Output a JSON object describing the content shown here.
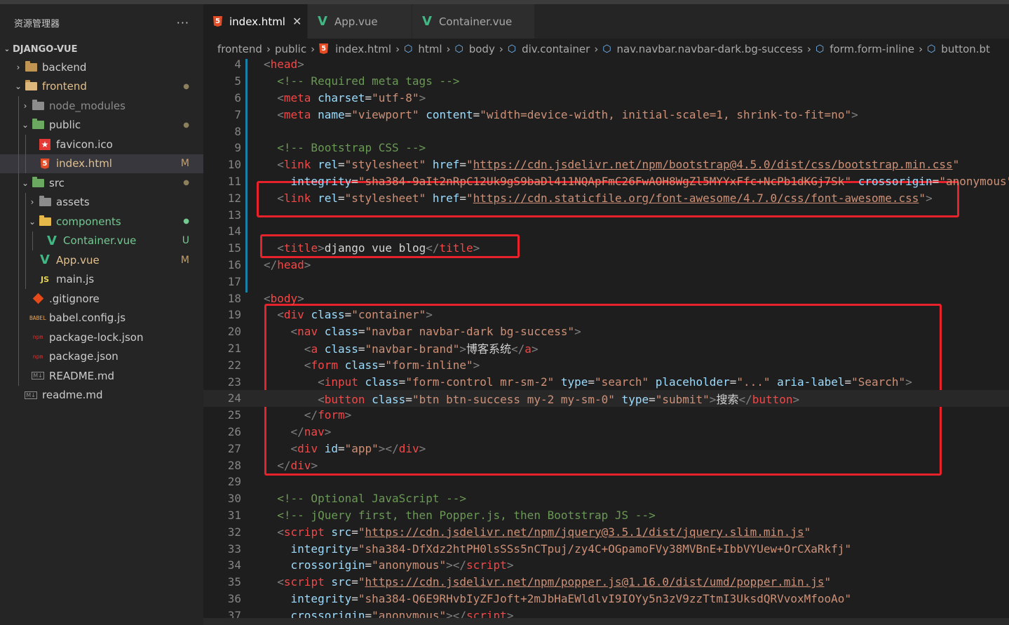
{
  "sidebar": {
    "title": "资源管理器",
    "more": "···",
    "root": "DJANGO-VUE",
    "items": [
      {
        "label": "backend",
        "depth": 0,
        "chev": "›",
        "icon": "folder-icon",
        "badge": ""
      },
      {
        "label": "frontend",
        "depth": 0,
        "chev": "⌄",
        "icon": "folder-open-icon",
        "badge": "●"
      },
      {
        "label": "node_modules",
        "depth": 1,
        "chev": "›",
        "icon": "node-folder-icon",
        "badge": ""
      },
      {
        "label": "public",
        "depth": 1,
        "chev": "⌄",
        "icon": "public-folder-icon",
        "badge": "●"
      },
      {
        "label": "favicon.ico",
        "depth": 2,
        "chev": "",
        "icon": "favicon-icon",
        "badge": ""
      },
      {
        "label": "index.html",
        "depth": 2,
        "chev": "",
        "icon": "html-icon",
        "badge": "M"
      },
      {
        "label": "src",
        "depth": 1,
        "chev": "⌄",
        "icon": "src-folder-icon",
        "badge": "●"
      },
      {
        "label": "assets",
        "depth": 2,
        "chev": "›",
        "icon": "assets-folder-icon",
        "badge": ""
      },
      {
        "label": "components",
        "depth": 2,
        "chev": "⌄",
        "icon": "components-folder-icon",
        "badge": "●"
      },
      {
        "label": "Container.vue",
        "depth": 3,
        "chev": "",
        "icon": "vue-icon",
        "badge": "U"
      },
      {
        "label": "App.vue",
        "depth": 2,
        "chev": "",
        "icon": "vue-icon",
        "badge": "M"
      },
      {
        "label": "main.js",
        "depth": 2,
        "chev": "",
        "icon": "js-icon",
        "badge": ""
      },
      {
        "label": ".gitignore",
        "depth": 1,
        "chev": "",
        "icon": "git-icon",
        "badge": ""
      },
      {
        "label": "babel.config.js",
        "depth": 1,
        "chev": "",
        "icon": "babel-icon",
        "badge": ""
      },
      {
        "label": "package-lock.json",
        "depth": 1,
        "chev": "",
        "icon": "npm-icon",
        "badge": ""
      },
      {
        "label": "package.json",
        "depth": 1,
        "chev": "",
        "icon": "npm-icon",
        "badge": ""
      },
      {
        "label": "README.md",
        "depth": 1,
        "chev": "",
        "icon": "markdown-icon",
        "badge": ""
      },
      {
        "label": "readme.md",
        "depth": 0,
        "chev": "",
        "icon": "markdown-icon",
        "badge": ""
      }
    ],
    "icon_text": {
      "html": "5",
      "vue": "V",
      "js": "JS",
      "babel": "BABEL",
      "npm": "npm",
      "md": "M↓"
    }
  },
  "tabs": [
    {
      "label": "index.html",
      "icon": "html-icon",
      "active": true,
      "close": "✕"
    },
    {
      "label": "App.vue",
      "icon": "vue-icon",
      "active": false,
      "close": ""
    },
    {
      "label": "Container.vue",
      "icon": "vue-icon",
      "active": false,
      "close": ""
    }
  ],
  "breadcrumb": [
    "frontend",
    "public",
    "index.html",
    "html",
    "body",
    "div.container",
    "nav.navbar.navbar-dark.bg-success",
    "form.form-inline",
    "button.bt"
  ],
  "code_lines": [
    {
      "n": "4",
      "tokens": [
        [
          "t",
          "<"
        ],
        [
          "tn",
          "head"
        ],
        [
          "t",
          ">"
        ]
      ]
    },
    {
      "n": "5",
      "tokens": [
        [
          "cm",
          "  <!-- Required meta tags -->"
        ]
      ]
    },
    {
      "n": "6",
      "tokens": [
        [
          "t",
          "  <"
        ],
        [
          "tn",
          "meta"
        ],
        [
          "an",
          " charset"
        ],
        [
          "tx",
          "="
        ],
        [
          "av",
          "\"utf-8\""
        ],
        [
          "t",
          ">"
        ]
      ]
    },
    {
      "n": "7",
      "tokens": [
        [
          "t",
          "  <"
        ],
        [
          "tn",
          "meta"
        ],
        [
          "an",
          " name"
        ],
        [
          "tx",
          "="
        ],
        [
          "av",
          "\"viewport\""
        ],
        [
          "an",
          " content"
        ],
        [
          "tx",
          "="
        ],
        [
          "av",
          "\"width=device-width, initial-scale=1, shrink-to-fit=no\""
        ],
        [
          "t",
          ">"
        ]
      ]
    },
    {
      "n": "8",
      "tokens": []
    },
    {
      "n": "9",
      "tokens": [
        [
          "cm",
          "  <!-- Bootstrap CSS -->"
        ]
      ]
    },
    {
      "n": "10",
      "tokens": [
        [
          "t",
          "  <"
        ],
        [
          "tn",
          "link"
        ],
        [
          "an",
          " rel"
        ],
        [
          "tx",
          "="
        ],
        [
          "av",
          "\"stylesheet\""
        ],
        [
          "an",
          " href"
        ],
        [
          "tx",
          "="
        ],
        [
          "av",
          "\""
        ],
        [
          "url",
          "https://cdn.jsdelivr.net/npm/bootstrap@4.5.0/dist/css/bootstrap.min.css"
        ],
        [
          "av",
          "\""
        ]
      ]
    },
    {
      "n": "11",
      "tokens": [
        [
          "an",
          "    integrity"
        ],
        [
          "tx",
          "="
        ],
        [
          "av",
          "\"sha384-9aIt2nRpC12Uk9gS9baDl411NQApFmC26FwAOH8WgZl5MYYxFfc+NcPb1dKGj7Sk\""
        ],
        [
          "an",
          " crossorigin"
        ],
        [
          "tx",
          "="
        ],
        [
          "av",
          "\"anonymous\""
        ]
      ]
    },
    {
      "n": "12",
      "tokens": [
        [
          "t",
          "  <"
        ],
        [
          "tn",
          "link"
        ],
        [
          "an",
          " rel"
        ],
        [
          "tx",
          "="
        ],
        [
          "av",
          "\"stylesheet\""
        ],
        [
          "an",
          " href"
        ],
        [
          "tx",
          "="
        ],
        [
          "av",
          "\""
        ],
        [
          "url",
          "https://cdn.staticfile.org/font-awesome/4.7.0/css/font-awesome.css"
        ],
        [
          "av",
          "\""
        ],
        [
          "t",
          ">"
        ]
      ]
    },
    {
      "n": "13",
      "tokens": []
    },
    {
      "n": "14",
      "tokens": []
    },
    {
      "n": "15",
      "tokens": [
        [
          "t",
          "  <"
        ],
        [
          "tn",
          "title"
        ],
        [
          "t",
          ">"
        ],
        [
          "tx",
          "django vue blog"
        ],
        [
          "t",
          "</"
        ],
        [
          "tn",
          "title"
        ],
        [
          "t",
          ">"
        ]
      ]
    },
    {
      "n": "16",
      "tokens": [
        [
          "t",
          "</"
        ],
        [
          "tn",
          "head"
        ],
        [
          "t",
          ">"
        ]
      ]
    },
    {
      "n": "17",
      "tokens": []
    },
    {
      "n": "18",
      "tokens": [
        [
          "t",
          "<"
        ],
        [
          "tn",
          "body"
        ],
        [
          "t",
          ">"
        ]
      ]
    },
    {
      "n": "19",
      "tokens": [
        [
          "t",
          "  <"
        ],
        [
          "tn",
          "div"
        ],
        [
          "an",
          " class"
        ],
        [
          "tx",
          "="
        ],
        [
          "av",
          "\"container\""
        ],
        [
          "t",
          ">"
        ]
      ]
    },
    {
      "n": "20",
      "tokens": [
        [
          "t",
          "    <"
        ],
        [
          "tn",
          "nav"
        ],
        [
          "an",
          " class"
        ],
        [
          "tx",
          "="
        ],
        [
          "av",
          "\"navbar navbar-dark bg-success\""
        ],
        [
          "t",
          ">"
        ]
      ]
    },
    {
      "n": "21",
      "tokens": [
        [
          "t",
          "      <"
        ],
        [
          "tn",
          "a"
        ],
        [
          "an",
          " class"
        ],
        [
          "tx",
          "="
        ],
        [
          "av",
          "\"navbar-brand\""
        ],
        [
          "t",
          ">"
        ],
        [
          "tx",
          "博客系统"
        ],
        [
          "t",
          "</"
        ],
        [
          "tn",
          "a"
        ],
        [
          "t",
          ">"
        ]
      ]
    },
    {
      "n": "22",
      "tokens": [
        [
          "t",
          "      <"
        ],
        [
          "tn",
          "form"
        ],
        [
          "an",
          " class"
        ],
        [
          "tx",
          "="
        ],
        [
          "av",
          "\"form-inline\""
        ],
        [
          "t",
          ">"
        ]
      ]
    },
    {
      "n": "23",
      "tokens": [
        [
          "t",
          "        <"
        ],
        [
          "tn",
          "input"
        ],
        [
          "an",
          " class"
        ],
        [
          "tx",
          "="
        ],
        [
          "av",
          "\"form-control mr-sm-2\""
        ],
        [
          "an",
          " type"
        ],
        [
          "tx",
          "="
        ],
        [
          "av",
          "\"search\""
        ],
        [
          "an",
          " placeholder"
        ],
        [
          "tx",
          "="
        ],
        [
          "av",
          "\"...\""
        ],
        [
          "an",
          " aria-label"
        ],
        [
          "tx",
          "="
        ],
        [
          "av",
          "\"Search\""
        ],
        [
          "t",
          ">"
        ]
      ]
    },
    {
      "n": "24",
      "tokens": [
        [
          "t",
          "        <"
        ],
        [
          "tn",
          "button"
        ],
        [
          "an",
          " class"
        ],
        [
          "tx",
          "="
        ],
        [
          "av",
          "\"btn btn-success my-2 my-sm-0\""
        ],
        [
          "an",
          " type"
        ],
        [
          "tx",
          "="
        ],
        [
          "av",
          "\"submit\""
        ],
        [
          "t",
          ">"
        ],
        [
          "tx",
          "搜索"
        ],
        [
          "t",
          "</"
        ],
        [
          "tn",
          "button"
        ],
        [
          "t",
          ">"
        ]
      ]
    },
    {
      "n": "25",
      "tokens": [
        [
          "t",
          "      </"
        ],
        [
          "tn",
          "form"
        ],
        [
          "t",
          ">"
        ]
      ]
    },
    {
      "n": "26",
      "tokens": [
        [
          "t",
          "    </"
        ],
        [
          "tn",
          "nav"
        ],
        [
          "t",
          ">"
        ]
      ]
    },
    {
      "n": "27",
      "tokens": [
        [
          "t",
          "    <"
        ],
        [
          "tn",
          "div"
        ],
        [
          "an",
          " id"
        ],
        [
          "tx",
          "="
        ],
        [
          "av",
          "\"app\""
        ],
        [
          "t",
          "></"
        ],
        [
          "tn",
          "div"
        ],
        [
          "t",
          ">"
        ]
      ]
    },
    {
      "n": "28",
      "tokens": [
        [
          "t",
          "  </"
        ],
        [
          "tn",
          "div"
        ],
        [
          "t",
          ">"
        ]
      ]
    },
    {
      "n": "29",
      "tokens": []
    },
    {
      "n": "30",
      "tokens": [
        [
          "cm",
          "  <!-- Optional JavaScript -->"
        ]
      ]
    },
    {
      "n": "31",
      "tokens": [
        [
          "cm",
          "  <!-- jQuery first, then Popper.js, then Bootstrap JS -->"
        ]
      ]
    },
    {
      "n": "32",
      "tokens": [
        [
          "t",
          "  <"
        ],
        [
          "tn",
          "script"
        ],
        [
          "an",
          " src"
        ],
        [
          "tx",
          "="
        ],
        [
          "av",
          "\""
        ],
        [
          "url",
          "https://cdn.jsdelivr.net/npm/jquery@3.5.1/dist/jquery.slim.min.js"
        ],
        [
          "av",
          "\""
        ]
      ]
    },
    {
      "n": "33",
      "tokens": [
        [
          "an",
          "    integrity"
        ],
        [
          "tx",
          "="
        ],
        [
          "av",
          "\"sha384-DfXdz2htPH0lsSSs5nCTpuj/zy4C+OGpamoFVy38MVBnE+IbbVYUew+OrCXaRkfj\""
        ]
      ]
    },
    {
      "n": "34",
      "tokens": [
        [
          "an",
          "    crossorigin"
        ],
        [
          "tx",
          "="
        ],
        [
          "av",
          "\"anonymous\""
        ],
        [
          "t",
          "></"
        ],
        [
          "tn",
          "script"
        ],
        [
          "t",
          ">"
        ]
      ]
    },
    {
      "n": "35",
      "tokens": [
        [
          "t",
          "  <"
        ],
        [
          "tn",
          "script"
        ],
        [
          "an",
          " src"
        ],
        [
          "tx",
          "="
        ],
        [
          "av",
          "\""
        ],
        [
          "url",
          "https://cdn.jsdelivr.net/npm/popper.js@1.16.0/dist/umd/popper.min.js"
        ],
        [
          "av",
          "\""
        ]
      ]
    },
    {
      "n": "36",
      "tokens": [
        [
          "an",
          "    integrity"
        ],
        [
          "tx",
          "="
        ],
        [
          "av",
          "\"sha384-Q6E9RHvbIyZFJoft+2mJbHaEWldlvI9IOYy5n3zV9zzTtmI3UksdQRVvoxMfooAo\""
        ]
      ]
    },
    {
      "n": "37",
      "tokens": [
        [
          "an",
          "    crossorigin"
        ],
        [
          "tx",
          "="
        ],
        [
          "av",
          "\"anonymous\""
        ],
        [
          "t",
          "></"
        ],
        [
          "tn",
          "script"
        ],
        [
          "t",
          ">"
        ]
      ]
    }
  ],
  "current_line": "24",
  "colors": {
    "highlight_box": "#e8222b",
    "accent": "#1b81a8"
  }
}
